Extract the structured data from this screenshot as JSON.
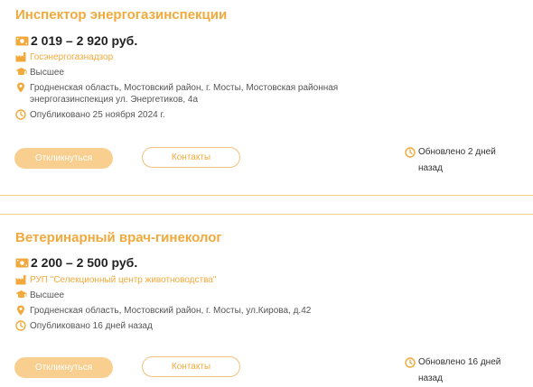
{
  "colors": {
    "accent": "#f2a93b",
    "button_fill": "#f8cf8e",
    "divider": "#f3cf86"
  },
  "vacancies": [
    {
      "title": "Инспектор энергогазинспекции",
      "salary": "2 019 – 2 920 руб.",
      "employer": "Госэнергогазнадзор",
      "education": "Высшее",
      "address": "Гродненская область, Мостовский район, г. Мосты, Мостовская районная энергогазинспекция ул. Энергетиков, 4а",
      "published": "Опубликовано 25 ноября 2024 г.",
      "apply_label": "Откликнуться",
      "contacts_label": "Контакты",
      "updated": "Обновлено 2 дней назад"
    },
    {
      "title": "Ветеринарный врач-гинеколог",
      "salary": "2 200 – 2 500 руб.",
      "employer": "РУП \"Селекционный центр животноводства\"",
      "education": "Высшее",
      "address": "Гродненская область, Мостовский район, г. Мосты, ул.Кирова, д.42",
      "published": "Опубликовано 16 дней назад",
      "apply_label": "Откликнуться",
      "contacts_label": "Контакты",
      "updated": "Обновлено 16 дней назад"
    }
  ],
  "icons": {
    "salary": "money-icon",
    "employer": "factory-icon",
    "education": "graduation-cap-icon",
    "address": "location-pin-icon",
    "published": "clock-icon",
    "updated": "clock-icon"
  }
}
